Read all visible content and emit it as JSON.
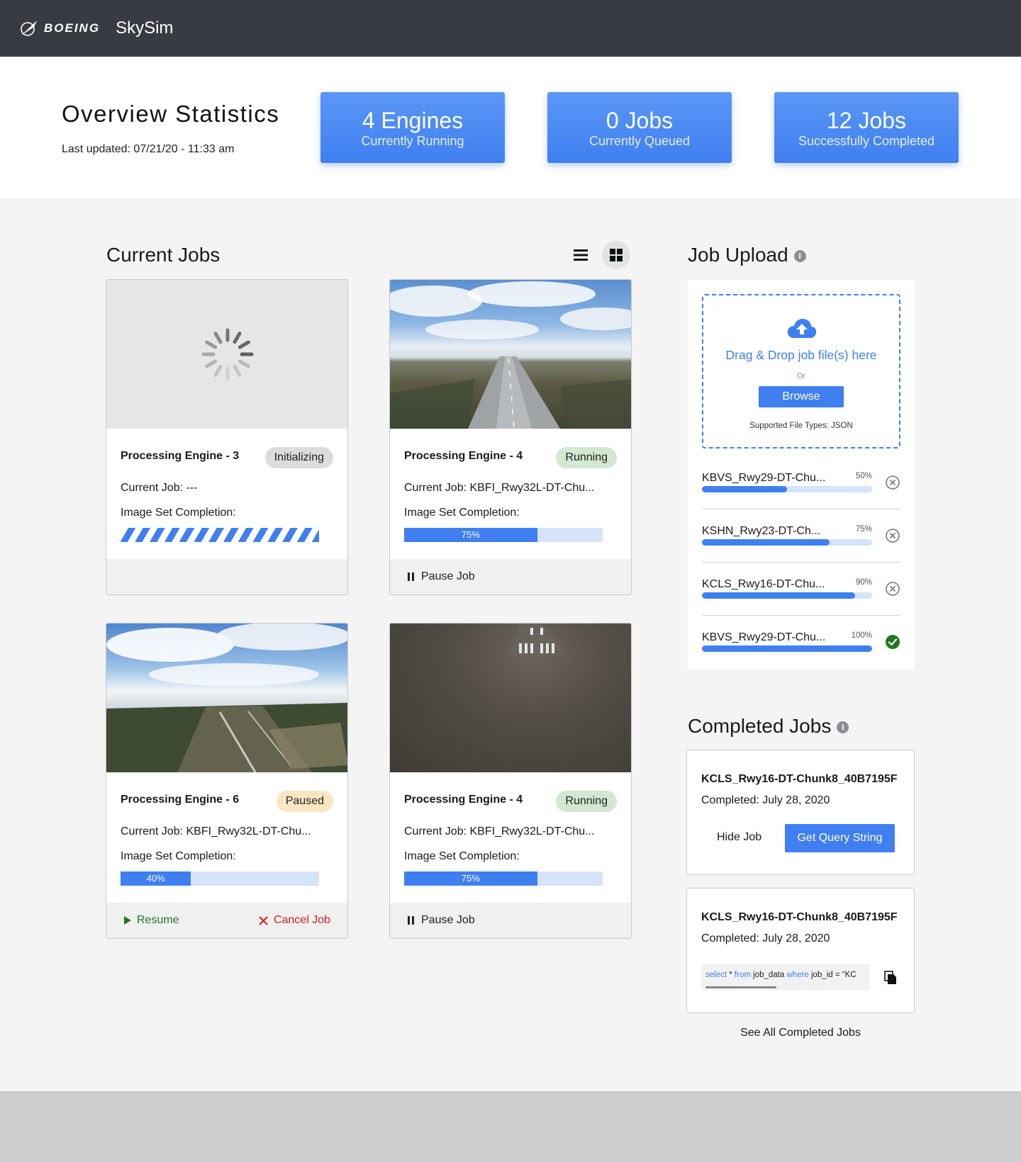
{
  "header": {
    "brand": "BOEING",
    "app_name": "SkySim"
  },
  "overview": {
    "title": "Overview Statistics",
    "last_updated": "Last updated:  07/21/20 - 11:33 am",
    "stats": [
      {
        "big": "4 Engines",
        "small": "Currently Running"
      },
      {
        "big": "0 Jobs",
        "small": "Currently Queued"
      },
      {
        "big": "12 Jobs",
        "small": "Successfully Completed"
      }
    ]
  },
  "current_jobs": {
    "title": "Current Jobs",
    "cards": [
      {
        "engine": "Processing Engine - 3",
        "status": "Initializing",
        "job": "Current Job: ---",
        "label": "Image Set Completion:",
        "progress": "",
        "actions": []
      },
      {
        "engine": "Processing Engine - 4",
        "status": "Running",
        "job": "Current Job: KBFI_Rwy32L-DT-Chu...",
        "label": "Image Set Completion:",
        "progress": "75%",
        "actions": [
          "Pause Job"
        ]
      },
      {
        "engine": "Processing Engine - 6",
        "status": "Paused",
        "job": "Current Job: KBFI_Rwy32L-DT-Chu...",
        "label": "Image Set Completion:",
        "progress": "40%",
        "actions": [
          "Resume",
          "Cancel Job"
        ]
      },
      {
        "engine": "Processing Engine - 4",
        "status": "Running",
        "job": "Current Job: KBFI_Rwy32L-DT-Chu...",
        "label": "Image Set Completion:",
        "progress": "75%",
        "actions": [
          "Pause Job"
        ]
      }
    ]
  },
  "job_upload": {
    "title": "Job Upload",
    "info_icon": "i",
    "drop_text": "Drag & Drop job file(s) here",
    "or_text": "Or",
    "browse": "Browse",
    "supported": "Supported File Types: JSON",
    "items": [
      {
        "name": "KBVS_Rwy29-DT-Chu...",
        "pct": "50%",
        "state": "cancel"
      },
      {
        "name": "KSHN_Rwy23-DT-Ch...",
        "pct": "75%",
        "state": "cancel"
      },
      {
        "name": "KCLS_Rwy16-DT-Chu...",
        "pct": "90%",
        "state": "cancel"
      },
      {
        "name": "KBVS_Rwy29-DT-Chu...",
        "pct": "100%",
        "state": "done"
      }
    ]
  },
  "completed_jobs": {
    "title": "Completed Jobs",
    "info_icon": "i",
    "cards": [
      {
        "name": "KCLS_Rwy16-DT-Chunk8_40B7195F",
        "date": "Completed: July 28, 2020",
        "hide": "Hide Job",
        "query_btn": "Get Query String"
      },
      {
        "name": "KCLS_Rwy16-DT-Chunk8_40B7195F",
        "date": "Completed: July 28, 2020",
        "query": {
          "select": "select",
          "star": " * ",
          "from": "from",
          "table": " job_data ",
          "where": "where",
          "rest": " job_id = “KC"
        }
      }
    ],
    "see_all": "See All Completed Jobs"
  },
  "colors": {
    "accent": "#3f7ff0",
    "topbar": "#383b41",
    "success": "#1f7a1f",
    "danger": "#d02020"
  }
}
